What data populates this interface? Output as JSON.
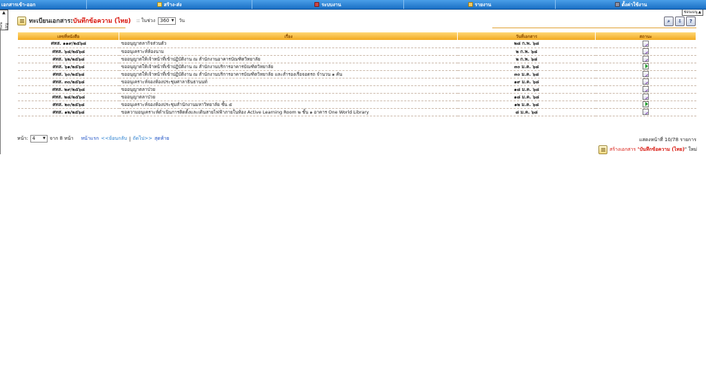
{
  "nav": {
    "items": [
      {
        "label": "เอกสารเข้า-ออก",
        "icon": ""
      },
      {
        "label": "สร้าง-ส่ง",
        "icon": "document-icon"
      },
      {
        "label": "ระบบงาน",
        "icon": "system-icon"
      },
      {
        "label": "รายงาน",
        "icon": "report-icon"
      },
      {
        "label": "ตั้งค่าใช้งาน",
        "icon": "settings-icon"
      }
    ]
  },
  "left_tab": {
    "label": "ซ่อนเมนู"
  },
  "right_tab": {
    "label": "ซ่อนเมนู"
  },
  "header": {
    "title_prefix": "ทะเบียนเอกสาร:",
    "title_type": "บันทึกข้อความ (ไทย)",
    "range_label": ":: ในช่วง",
    "range_value": "360",
    "range_unit": "วัน"
  },
  "table": {
    "headers": [
      "เลขที่หนังสือ",
      "เรื่อง",
      "วันที่เอกสาร",
      "สถานะ"
    ],
    "rows": [
      {
        "no": "ศทส. ๑๑๙/๒๕๖๘",
        "subject": "ขออนุญาตลากิจส่วนตัว",
        "date": "๒๘ ก.พ. ๖๘",
        "status": "edit"
      },
      {
        "no": "ศทส. ๖๘/๒๕๖๘",
        "subject": "ขออนุเคราะห์ห้องนาม",
        "date": "๒ ก.พ. ๖๘",
        "status": "edit"
      },
      {
        "no": "ศทส. ๖๒/๒๕๖๘",
        "subject": "ขออนุญาตให้เจ้าหน้าที่เข้าปฏิบัติงาน ณ สำนักงานอาคารบัณฑิตวิทยาลัย",
        "date": "๒ ก.พ. ๖๘",
        "status": "edit"
      },
      {
        "no": "ศทส. ๖๑/๒๕๖๘",
        "subject": "ขออนุญาตให้เจ้าหน้าที่เข้าปฏิบัติงาน ณ สำนักงานบริการอาคารบัณฑิตวิทยาลัย",
        "date": "๓๐ ม.ค. ๖๘",
        "status": "sent"
      },
      {
        "no": "ศทส. ๖๐/๒๕๖๘",
        "subject": "ขออนุญาตให้เจ้าหน้าที่เข้าปฏิบัติงาน ณ สำนักงานบริการอาคารบัณฑิตวิทยาลัย และสำรองเรือจอดรถ จำนวน ๑ คัน",
        "date": "๓๐ ม.ค. ๖๘",
        "status": "edit"
      },
      {
        "no": "ศทส. ๓๐/๒๕๖๘",
        "subject": "ขออนุเคราะห์จองห้องประชุมศาลาธินธานนท์",
        "date": "๑๙ ม.ค. ๖๘",
        "status": "edit"
      },
      {
        "no": "ศทส. ๒๙/๒๕๖๘",
        "subject": "ขออนุญาตลาป่วย",
        "date": "๑๘ ม.ค. ๖๘",
        "status": "edit"
      },
      {
        "no": "ศทส. ๒๘/๒๕๖๘",
        "subject": "ขออนุญาตลาป่วย",
        "date": "๑๘ ม.ค. ๖๘",
        "status": "edit"
      },
      {
        "no": "ศทส. ๒๐/๒๕๖๘",
        "subject": "ขออนุเคราะห์จองห้องประชุมสำนักงานมหาวิทยาลัย ชั้น ๕",
        "date": "๑๒ ม.ค. ๖๘",
        "status": "sent"
      },
      {
        "no": "ศทส. ๑๒/๒๕๖๘",
        "subject": "ขอความอนุเคราะห์ดำเนินการติดตั้งและเดินสายไฟฟ้าภายในห้อง Active Learning Room ๒ ชั้น ๑ อาคาร One World Library",
        "date": "๘ ม.ค. ๖๘",
        "status": "edit"
      }
    ]
  },
  "pager": {
    "page_label": "หน้า:",
    "page_value": "4",
    "of_label": "จาก 8 หน้า",
    "first": "หน้าแรก",
    "prev": "<<ย้อนกลับ",
    "sep": "|",
    "next": "ถัดไป>>",
    "last": "สุดท้าย",
    "row_info": "แสดงหน้าที่ 10/78 รายการ"
  },
  "new_doc": {
    "prefix": "สร้างเอกสาร \"",
    "type": "บันทึกข้อความ (ไทย)",
    "suffix": "\" ใหม่"
  },
  "colors": {
    "accent_red": "#d8140b",
    "nav_blue": "#1a6fc4",
    "table_header": "#f2a91f"
  }
}
